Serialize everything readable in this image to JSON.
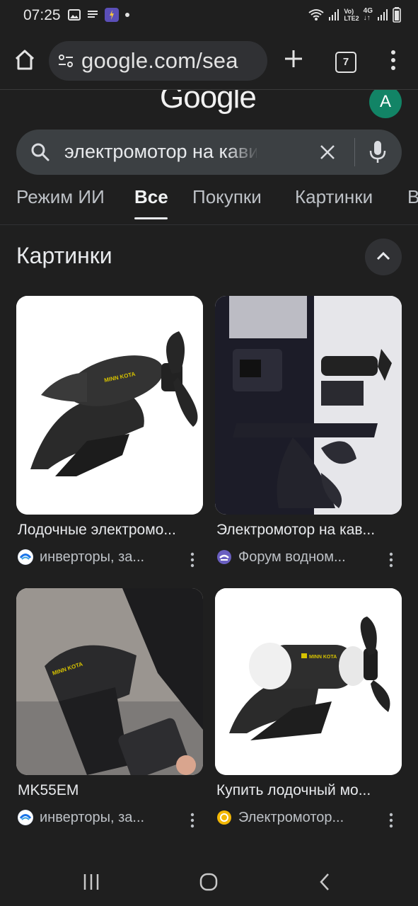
{
  "status_bar": {
    "time": "07:25",
    "network_label": "LTE2",
    "network_type": "4G",
    "volte": "Vo)"
  },
  "browser": {
    "url": "google.com/sea",
    "tab_count": "7"
  },
  "header": {
    "logo": "Google",
    "avatar_letter": "A",
    "avatar_color": "#128466"
  },
  "search": {
    "query": "электромотор на кавит"
  },
  "tabs": [
    {
      "label": "Режим ИИ"
    },
    {
      "label": "Все"
    },
    {
      "label": "Покупки"
    },
    {
      "label": "Картинки"
    },
    {
      "label": "В"
    }
  ],
  "images_section": {
    "title": "Картинки",
    "results": [
      {
        "caption": "Лодочные электромо...",
        "source": "инверторы, за...",
        "favicon": "swirl-blue-icon"
      },
      {
        "caption": "Электромотор на кав...",
        "source": "Форум водном...",
        "favicon": "forum-purple-icon"
      },
      {
        "caption": "MK55EM",
        "source": "инверторы, за...",
        "favicon": "swirl-blue-icon"
      },
      {
        "caption": "Купить лодочный мо...",
        "source": "Электромотор...",
        "favicon": "yellow-circle-icon"
      }
    ]
  }
}
